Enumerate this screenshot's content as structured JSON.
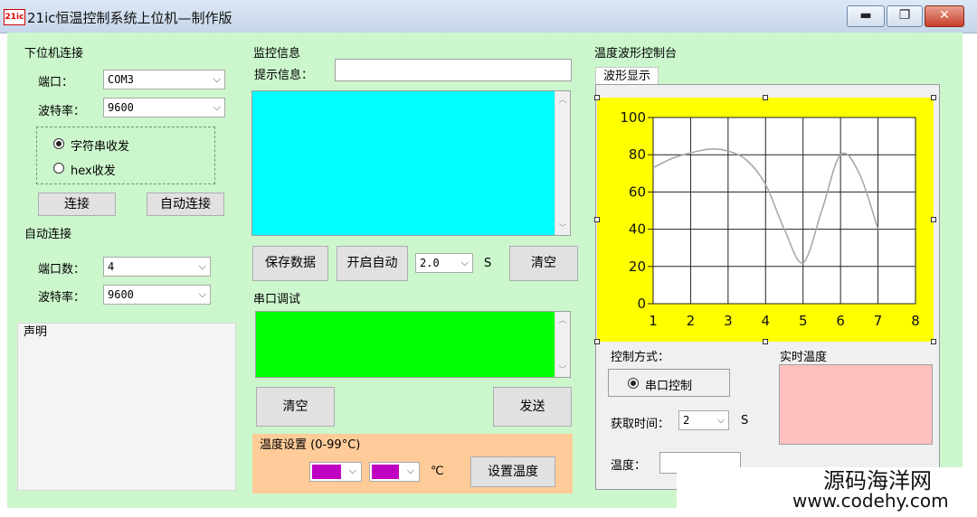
{
  "window": {
    "icon_text": "21ic",
    "title": "21ic恒温控制系统上位机—制作版",
    "min_glyph": "▬",
    "max_glyph": "❐",
    "close_glyph": "✕"
  },
  "lower": {
    "title": "下位机连接",
    "port_label": "端口：",
    "port_value": "COM3",
    "baud_label": "波特率：",
    "baud_value": "9600",
    "radio_string": "字符串收发",
    "radio_hex": "hex收发",
    "connect": "连接",
    "auto_connect": "自动连接"
  },
  "auto": {
    "title": "自动连接",
    "count_label": "端口数：",
    "count_value": "4",
    "baud_label": "波特率：",
    "baud_value": "9600"
  },
  "statement": {
    "title": "声明"
  },
  "monitor": {
    "title": "监控信息",
    "prompt_label": "提示信息：",
    "prompt_value": "",
    "save": "保存数据",
    "auto_start": "开启自动",
    "interval_value": "2.0",
    "unit_s": "S",
    "clear": "清空"
  },
  "serial": {
    "title": "串口调试",
    "clear": "清空",
    "send": "发送"
  },
  "temp_set": {
    "title": "温度设置 (0-99°C)",
    "unit": "℃",
    "set_button": "设置温度"
  },
  "wave": {
    "title": "温度波形控制台",
    "tab": "波形显示"
  },
  "control": {
    "mode_label": "控制方式：",
    "serial_control": "串口控制",
    "time_label": "获取时间：",
    "time_value": "2",
    "unit_s": "S",
    "temp_label": "温度：",
    "realtime_label": "实时温度"
  },
  "watermark": {
    "line1": "源码海洋网",
    "line2": "www.codehy.com"
  },
  "colors": {
    "client_bg": "#ccf6cc",
    "monitor_box": "#00ffff",
    "serial_box": "#00ff00",
    "temp_panel": "#ffcc99",
    "chart_bg": "#ffff00",
    "realtime_box": "#ffc0c0",
    "combo_magenta": "#c000c0",
    "curve": "#a8a8a8"
  },
  "chart_data": {
    "type": "line",
    "x": [
      1,
      1.5,
      2,
      2.5,
      3,
      3.5,
      4,
      4.5,
      5,
      5.5,
      6,
      6.5,
      7
    ],
    "series": [
      {
        "values": [
          73,
          78,
          81,
          83,
          82,
          77,
          64,
          40,
          22,
          50,
          80,
          70,
          40
        ]
      }
    ],
    "xlim": [
      1,
      8
    ],
    "ylim": [
      0,
      100
    ],
    "x_ticks": [
      1,
      2,
      3,
      4,
      5,
      6,
      7,
      8
    ],
    "y_ticks": [
      0,
      20,
      40,
      60,
      80,
      100
    ],
    "grid": true
  }
}
